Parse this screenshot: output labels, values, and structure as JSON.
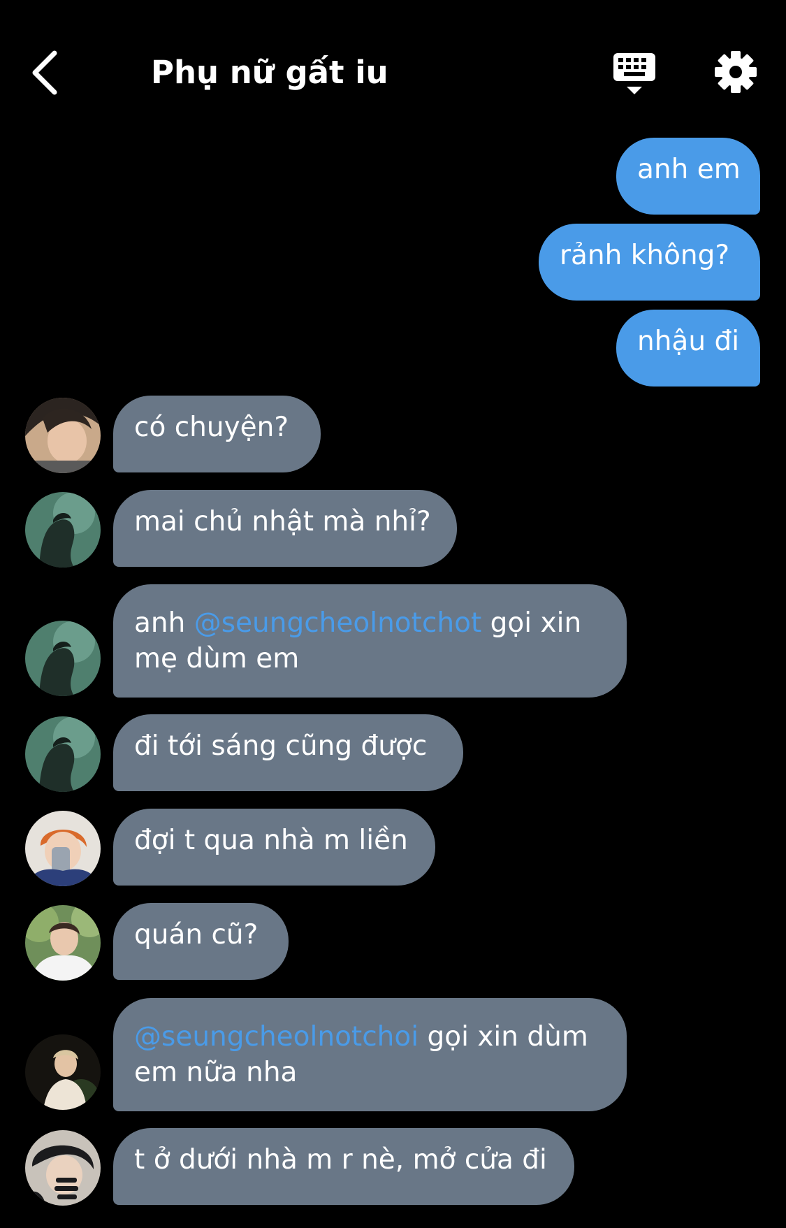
{
  "header": {
    "title": "Phụ nữ gất iu",
    "back_icon": "chevron-left-icon",
    "keyboard_icon": "keyboard-hide-icon",
    "settings_icon": "gear-icon"
  },
  "colors": {
    "background": "#000000",
    "outgoing_bubble": "#4a9be8",
    "incoming_bubble": "#697787",
    "mention": "#4a9be8",
    "text": "#ffffff"
  },
  "messages": {
    "out1": "anh em",
    "out2": "rảnh không?",
    "out3": "nhậu đi",
    "in1": "có chuyện?",
    "in2": "mai chủ nhật mà nhỉ?",
    "in3": {
      "prefix": "anh ",
      "mention": "@seungcheolnotchot",
      "suffix": " gọi xin",
      "line2": "mẹ dùm em"
    },
    "in4": "đi tới sáng cũng được",
    "in5": "đợi t qua nhà m liền",
    "in6": "quán cũ?",
    "in7": {
      "mention": "@seungcheolnotchoi",
      "suffix": " gọi xin dùm",
      "line2": "em nữa nha"
    },
    "in8": "t ở dưới nhà m r nè, mở cửa đi"
  }
}
